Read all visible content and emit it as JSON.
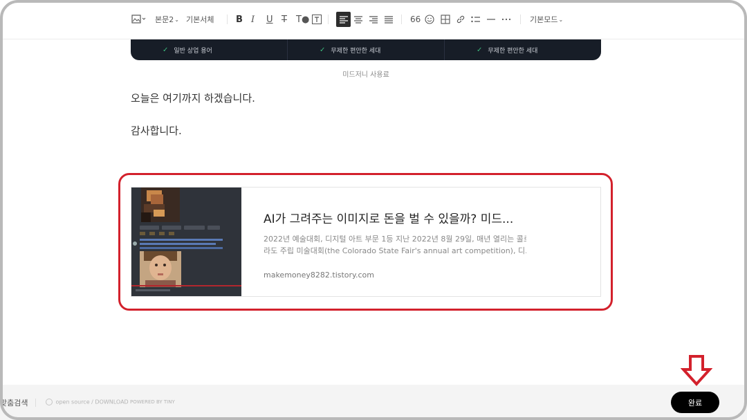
{
  "toolbar": {
    "paragraph_style": "본문2",
    "font": "기본서체",
    "mode": "기본모드",
    "quote_label": "66"
  },
  "banner": {
    "features": [
      "일반 상업 용어",
      "무제한 편안한 세대",
      "무제한 편안한 세대"
    ]
  },
  "caption": "미드저니 사용료",
  "body": {
    "line1": "오늘은 여기까지 하겠습니다.",
    "line2": "감사합니다."
  },
  "link_card": {
    "title": "AI가 그려주는 이미지로 돈을 벌 수 있을까? 미드...",
    "desc_line1": "2022년 예술대회, 디지털 아트 부문 1등 지난 2022년 8월 29일, 매년 열리는 콜로",
    "desc_line2": "라도 주립 미술대회(the Colorado State Fair's annual art competition), 디...",
    "url": "makemoney8282.tistory.com"
  },
  "footer": {
    "left_text": "맞춤검색",
    "open_source": "open source / DOWNLOAD",
    "powered": "POWERED BY TINY",
    "done": "완료"
  },
  "colors": {
    "highlight": "#d3212c",
    "banner_bg": "#171d27",
    "done_bg": "#000000"
  }
}
